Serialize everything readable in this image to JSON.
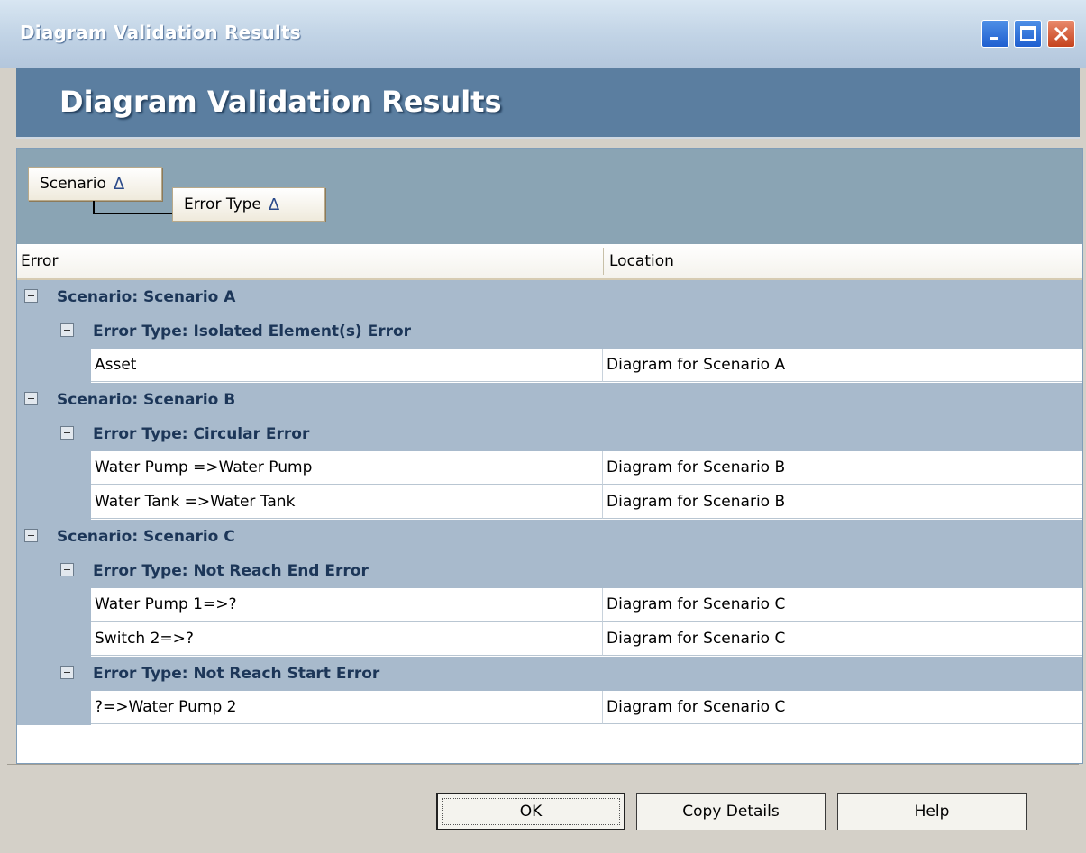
{
  "window": {
    "title": "Diagram Validation Results",
    "controls": [
      "minimize-icon",
      "maximize-icon",
      "close-icon"
    ]
  },
  "header": {
    "title": "Diagram Validation Results"
  },
  "grouping": {
    "chips": [
      {
        "label": "Scenario",
        "sort": "ascending",
        "icon": "sort-ascending-icon"
      },
      {
        "label": "Error Type",
        "sort": "ascending",
        "icon": "sort-ascending-icon"
      }
    ],
    "sort_glyph": "Δ"
  },
  "columns": {
    "error": "Error",
    "location": "Location"
  },
  "groups": [
    {
      "label": "Scenario: Scenario A",
      "subgroups": [
        {
          "label": "Error Type: Isolated Element(s) Error",
          "rows": [
            {
              "error": "Asset",
              "location": "Diagram for Scenario A"
            }
          ]
        }
      ]
    },
    {
      "label": "Scenario: Scenario B",
      "subgroups": [
        {
          "label": "Error Type: Circular Error",
          "rows": [
            {
              "error": "Water Pump =>Water Pump",
              "location": "Diagram for Scenario B"
            },
            {
              "error": "Water Tank =>Water Tank",
              "location": "Diagram for Scenario B"
            }
          ]
        }
      ]
    },
    {
      "label": "Scenario: Scenario C",
      "subgroups": [
        {
          "label": "Error Type: Not Reach End Error",
          "rows": [
            {
              "error": "Water Pump 1=>?",
              "location": "Diagram for Scenario C"
            },
            {
              "error": "Switch 2=>?",
              "location": "Diagram for Scenario C"
            }
          ]
        },
        {
          "label": "Error Type: Not Reach Start Error",
          "rows": [
            {
              "error": "?=>Water Pump 2",
              "location": "Diagram for Scenario C"
            }
          ]
        }
      ]
    }
  ],
  "buttons": {
    "ok": "OK",
    "copy": "Copy Details",
    "help": "Help"
  },
  "colors": {
    "header_bg": "#5b7ea0",
    "group_row_bg": "#a8bacc",
    "group_text": "#1c3658",
    "groupby_bar_bg": "#8aa4b4"
  }
}
